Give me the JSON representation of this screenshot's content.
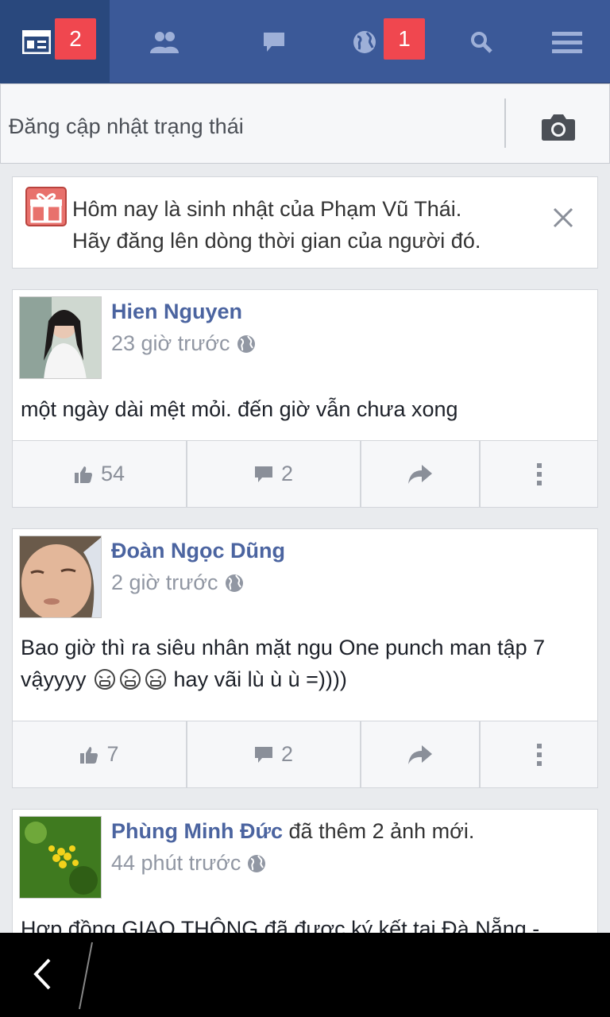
{
  "nav": {
    "items": [
      {
        "name": "news-feed-icon",
        "badge": "2"
      },
      {
        "name": "friends-icon",
        "badge": ""
      },
      {
        "name": "messages-icon",
        "badge": ""
      },
      {
        "name": "notifications-globe-icon",
        "badge": "1"
      },
      {
        "name": "search-icon",
        "badge": ""
      },
      {
        "name": "menu-icon",
        "badge": ""
      }
    ],
    "colors": {
      "bar": "#3b5998",
      "active": "#29487d",
      "badge": "#f0474f"
    }
  },
  "status": {
    "placeholder": "Đăng cập nhật trạng thái",
    "camera_icon": "camera-icon"
  },
  "birthday": {
    "line1": "Hôm nay là sinh nhật của Phạm Vũ Thái.",
    "line2": "Hãy đăng lên dòng thời gian của người đó.",
    "gift_icon": "gift-icon",
    "close_icon": "close-icon"
  },
  "posts": [
    {
      "author": "Hien Nguyen",
      "suffix": "",
      "time": "23 giờ trước",
      "body": "một ngày dài mệt mỏi. đến giờ vẫn chưa xong",
      "likes": "54",
      "comments": "2"
    },
    {
      "author": "Đoàn Ngọc Dũng",
      "suffix": "",
      "time": "2 giờ trước",
      "body_line1": "Bao giờ thì ra siêu nhân mặt ngu One punch man tập 7",
      "body_line2_a": "vậyyyy",
      "body_line2_b": "hay vãi lù ù ù =))))",
      "likes": "7",
      "comments": "2"
    },
    {
      "author": "Phùng Minh Đức",
      "suffix": " đã thêm 2 ảnh mới.",
      "time": "44 phút trước",
      "body": "Hợp đồng GIAO THÔNG đã được ký kết tại Đà Nẵng -"
    }
  ]
}
